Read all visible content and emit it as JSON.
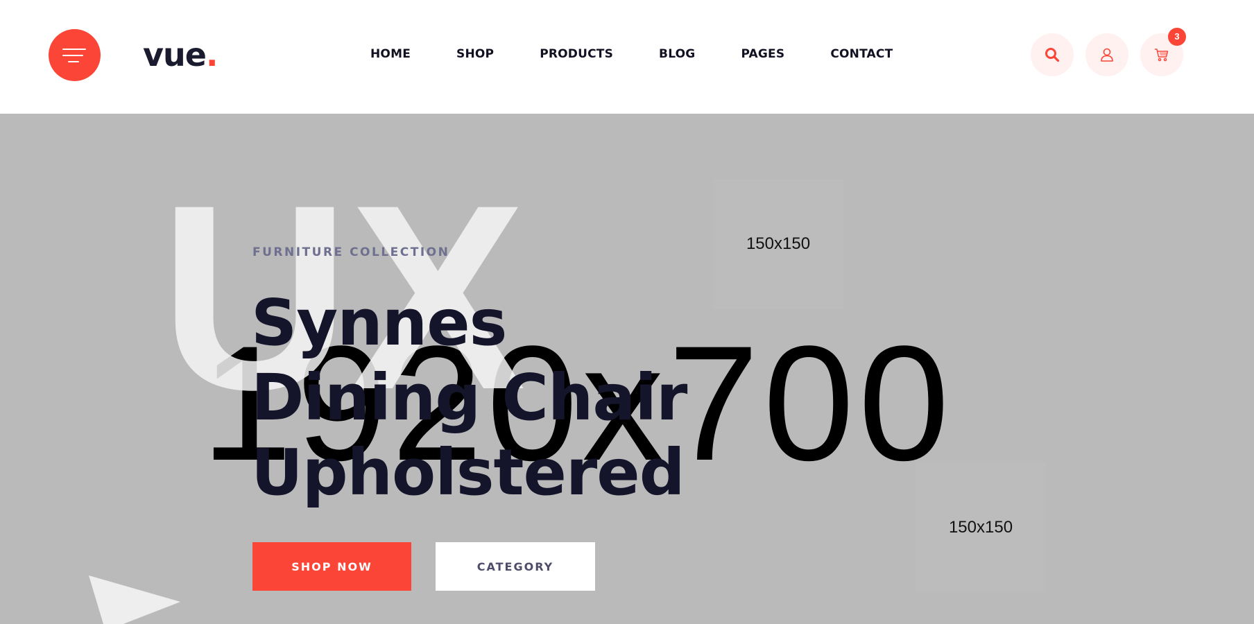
{
  "header": {
    "logo_text": "vue",
    "logo_dot": ".",
    "nav": [
      "HOME",
      "SHOP",
      "PRODUCTS",
      "BLOG",
      "PAGES",
      "CONTACT"
    ],
    "cart_count": "3",
    "icons": [
      "search-icon",
      "user-icon",
      "cart-icon"
    ]
  },
  "hero": {
    "eyebrow": "FURNITURE COLLECTION",
    "title_lines": [
      "Synnes",
      "Dining Chair",
      "Upholstered"
    ],
    "background_text": "UX",
    "placeholder_main": "1920x700",
    "placeholder_small_1": "150x150",
    "placeholder_small_2": "150x150",
    "primary_button": "SHOP NOW",
    "secondary_button": "CATEGORY"
  },
  "colors": {
    "accent": "#fa4537",
    "dark": "#14142a",
    "hero_bg": "#bababa"
  }
}
